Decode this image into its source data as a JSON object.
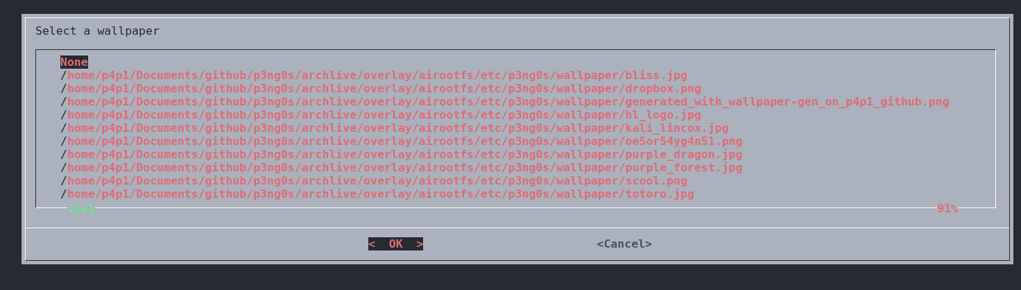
{
  "dialog": {
    "title": "Select a wallpaper"
  },
  "list": {
    "items": [
      {
        "label": "None",
        "selected": true
      },
      {
        "label": "/home/p4p1/Documents/github/p3ng0s/archlive/overlay/airootfs/etc/p3ng0s/wallpaper/bliss.jpg",
        "selected": false
      },
      {
        "label": "/home/p4p1/Documents/github/p3ng0s/archlive/overlay/airootfs/etc/p3ng0s/wallpaper/dropbox.png",
        "selected": false
      },
      {
        "label": "/home/p4p1/Documents/github/p3ng0s/archlive/overlay/airootfs/etc/p3ng0s/wallpaper/generated_with_wallpaper-gen_on_p4p1_github.png",
        "selected": false
      },
      {
        "label": "/home/p4p1/Documents/github/p3ng0s/archlive/overlay/airootfs/etc/p3ng0s/wallpaper/hl_logo.jpg",
        "selected": false
      },
      {
        "label": "/home/p4p1/Documents/github/p3ng0s/archlive/overlay/airootfs/etc/p3ng0s/wallpaper/kali_lincox.jpg",
        "selected": false
      },
      {
        "label": "/home/p4p1/Documents/github/p3ng0s/archlive/overlay/airootfs/etc/p3ng0s/wallpaper/oe5or54yg4n51.png",
        "selected": false
      },
      {
        "label": "/home/p4p1/Documents/github/p3ng0s/archlive/overlay/airootfs/etc/p3ng0s/wallpaper/purple_dragon.jpg",
        "selected": false
      },
      {
        "label": "/home/p4p1/Documents/github/p3ng0s/archlive/overlay/airootfs/etc/p3ng0s/wallpaper/purple_forest.jpg",
        "selected": false
      },
      {
        "label": "/home/p4p1/Documents/github/p3ng0s/archlive/overlay/airootfs/etc/p3ng0s/wallpaper/scool.png",
        "selected": false
      },
      {
        "label": "/home/p4p1/Documents/github/p3ng0s/archlive/overlay/airootfs/etc/p3ng0s/wallpaper/totoro.jpg",
        "selected": false
      }
    ],
    "scroll_indicator": "↓(+)",
    "scroll_percent": "91%"
  },
  "buttons": [
    {
      "label": "<  OK  >",
      "selected": true
    },
    {
      "label": "<Cancel>",
      "selected": false
    }
  ]
}
